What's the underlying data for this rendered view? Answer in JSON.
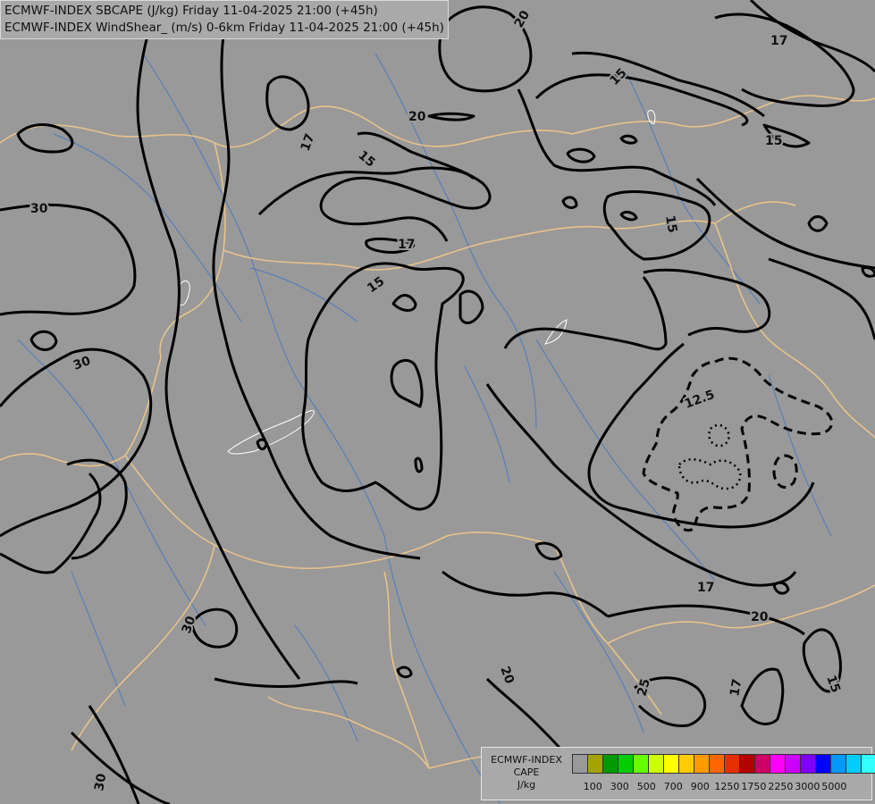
{
  "header": {
    "line1": "ECMWF-INDEX SBCAPE (J/kg) Friday 11-04-2025 21:00 (+45h)",
    "line2": "ECMWF-INDEX WindShear_ (m/s) 0-6km Friday 11-04-2025 21:00 (+45h)"
  },
  "contour_labels": {
    "l20a": "20",
    "l17a": "17",
    "l15a": "15",
    "l20b": "20",
    "l17b": "17",
    "l15b": "15",
    "l15c": "15",
    "l30a": "30",
    "l17c": "17",
    "l15d": "15",
    "l30b": "30",
    "l12": "12.5",
    "l17d": "17",
    "l20c": "20",
    "l30c": "30",
    "l20d": "20",
    "l25": "25",
    "l17e": "17",
    "l15e": "15",
    "l30d": "30",
    "l15f": "15"
  },
  "legend": {
    "title1": "ECMWF-INDEX",
    "title2": "CAPE",
    "title3": "J/kg",
    "colors": [
      "#999999",
      "#a4a400",
      "#009900",
      "#00cc00",
      "#66ff00",
      "#ccff00",
      "#ffff00",
      "#ffcc00",
      "#ff9900",
      "#ff6600",
      "#e62e00",
      "#b30000",
      "#cc0066",
      "#ff00ff",
      "#cc00ff",
      "#7f00ff",
      "#0000ff",
      "#0099ff",
      "#00ccff",
      "#33ffff",
      "#ffffff"
    ],
    "ticks": [
      "100",
      "300",
      "500",
      "700",
      "900",
      "1250",
      "1750",
      "2250",
      "3000",
      "5000"
    ]
  },
  "colors": {
    "background": "#999999",
    "border_lines": "#e8c38a",
    "rivers": "#4a7cc0",
    "windshear_contours": "#000000",
    "cape_contour": "#ffffff"
  }
}
